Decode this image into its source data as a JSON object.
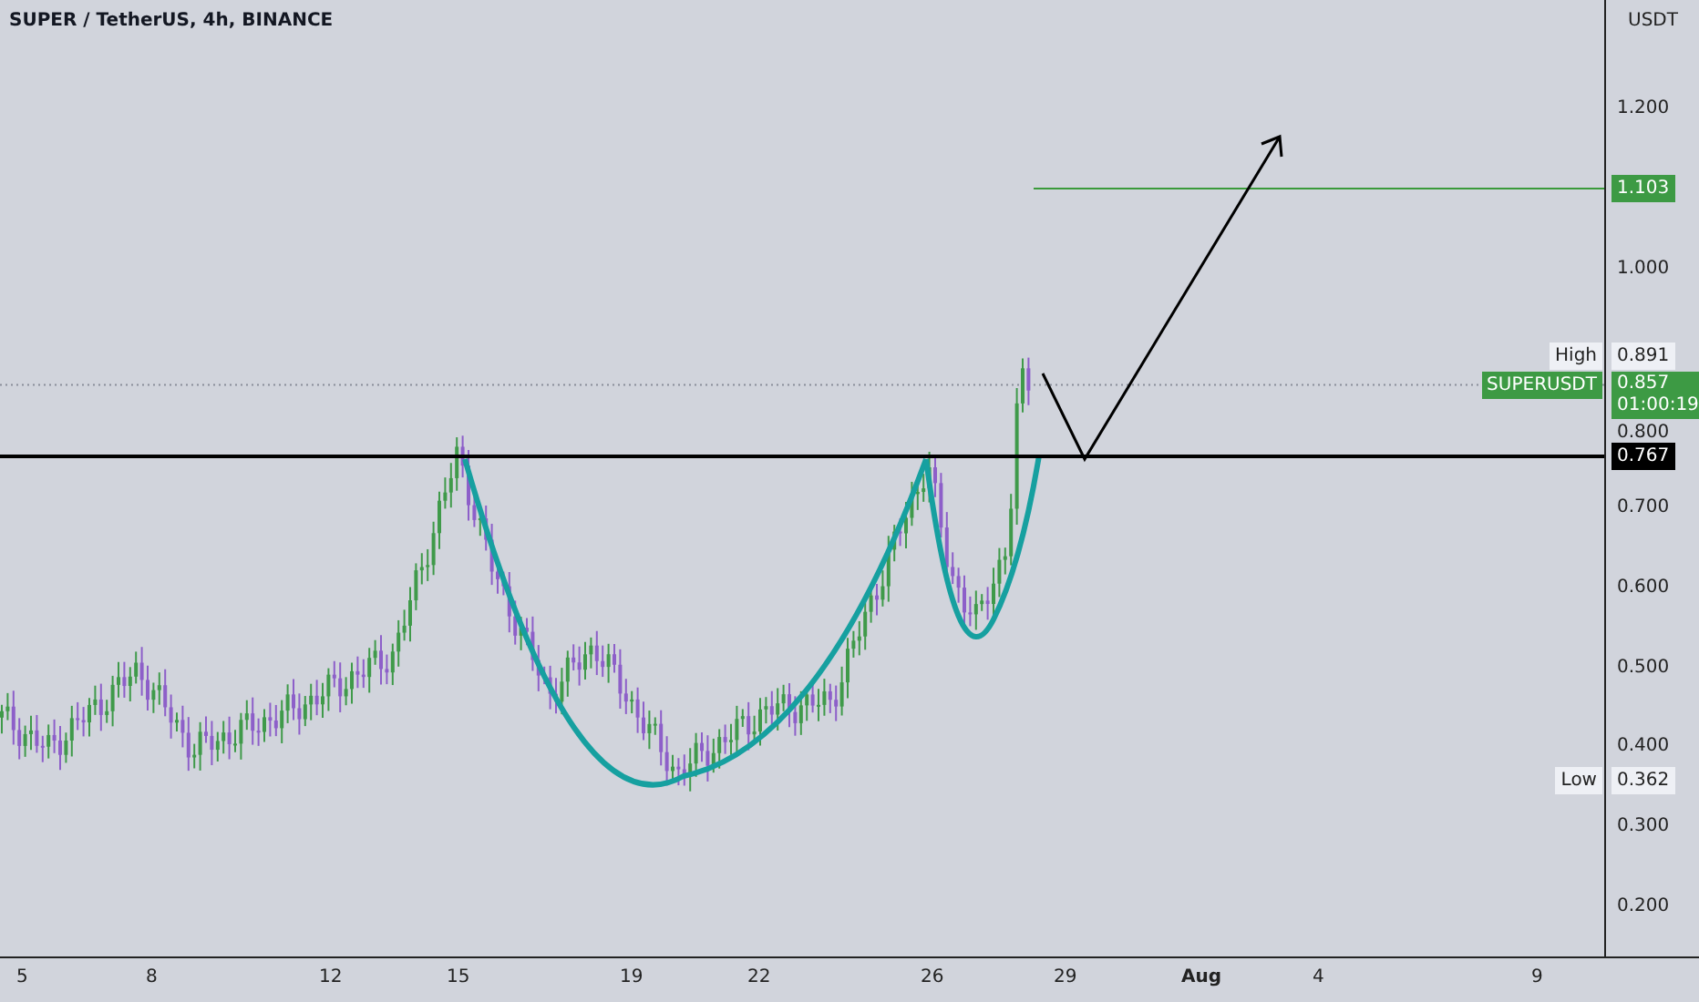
{
  "title": "SUPER / TetherUS, 4h, BINANCE",
  "price_axis": {
    "unit": "USDT",
    "ticks": [
      "1.200",
      "1.000",
      "0.800",
      "0.700",
      "0.600",
      "0.500",
      "0.400",
      "0.300",
      "0.200"
    ]
  },
  "time_axis": [
    {
      "text": "5",
      "kind": "day"
    },
    {
      "text": "8",
      "kind": "day"
    },
    {
      "text": "12",
      "kind": "day"
    },
    {
      "text": "15",
      "kind": "day"
    },
    {
      "text": "19",
      "kind": "day"
    },
    {
      "text": "22",
      "kind": "day"
    },
    {
      "text": "26",
      "kind": "day"
    },
    {
      "text": "29",
      "kind": "day"
    },
    {
      "text": "Aug",
      "kind": "month"
    },
    {
      "text": "4",
      "kind": "day"
    },
    {
      "text": "9",
      "kind": "day"
    }
  ],
  "target_label": "1.103",
  "high": {
    "label": "High",
    "value": "0.891"
  },
  "symbol": {
    "label": "SUPERUSDT",
    "value": "0.857",
    "countdown": "01:00:19"
  },
  "resistance_label": "0.767",
  "low": {
    "label": "Low",
    "value": "0.362"
  }
}
